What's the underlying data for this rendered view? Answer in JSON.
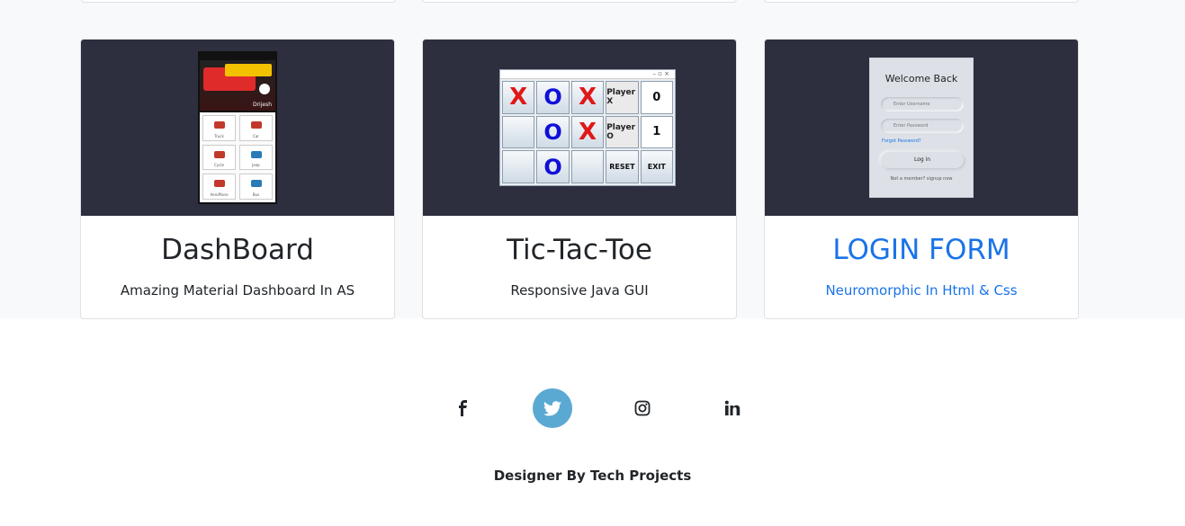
{
  "projects": [
    {
      "title": "DashBoard",
      "subtitle": "Amazing Material Dashboard In AS",
      "active": false,
      "thumbnail": {
        "profile_name": "Drijesh",
        "tiles": [
          "Truck",
          "Car",
          "Cycle",
          "Jeep",
          "AeroPlane",
          "Bus"
        ]
      }
    },
    {
      "title": "Tic-Tac-Toe",
      "subtitle": "Responsive Java GUI",
      "active": false,
      "thumbnail": {
        "window_controls": "–  ▫  ×",
        "cells": [
          "X",
          "O",
          "X",
          "Player X",
          "0",
          "",
          "O",
          "X",
          "Player O",
          "1",
          "",
          "O",
          "",
          "RESET",
          "EXIT"
        ]
      }
    },
    {
      "title": "LOGIN FORM",
      "subtitle": "Neuromorphic In Html & Css",
      "active": true,
      "thumbnail": {
        "heading": "Welcome Back",
        "username_placeholder": "Enter Username",
        "password_placeholder": "Enter Password",
        "forgot": "Forgot Password?",
        "button": "Log in",
        "footer": "Not a member? signup now"
      }
    }
  ],
  "social_links": [
    {
      "icon": "facebook-icon",
      "active": false
    },
    {
      "icon": "twitter-icon",
      "active": true
    },
    {
      "icon": "instagram-icon",
      "active": false
    },
    {
      "icon": "linkedin-icon",
      "active": false
    }
  ],
  "footer": {
    "credit": "Designer By Tech Projects"
  },
  "colors": {
    "accent": "#1a73e8",
    "card_image_bg": "#2d2f3e",
    "social_active": "#5aa9d3",
    "section_bg": "#f8f9fa"
  }
}
